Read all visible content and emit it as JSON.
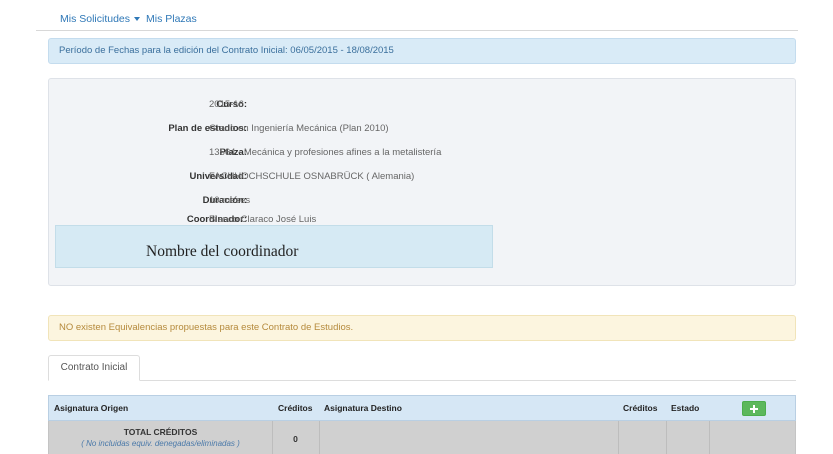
{
  "nav": {
    "solicitudes_label": "Mis Solicitudes",
    "plazas_label": "Mis Plazas"
  },
  "period_alert": "Período de Fechas para la edición del Contrato Inicial: 06/05/2015 - 18/08/2015",
  "info": {
    "rows": [
      {
        "label": "Curso:",
        "value": "2015-16"
      },
      {
        "label": "Plan de estudios:",
        "value": "Grado en Ingeniería Mecánica (Plan 2010)"
      },
      {
        "label": "Plaza:",
        "value": "13564 - Mecánica y profesiones afines a la metalistería"
      },
      {
        "label": "Universidad:",
        "value": "FACHHOCHSCHULE OSNABRÜCK ( Alemania)"
      },
      {
        "label": "Duración:",
        "value": "10 meses"
      },
      {
        "label": "Coordinador:",
        "value": "Blanco Claraco José Luis"
      }
    ]
  },
  "annotation": {
    "text": "Nombre del coordinador"
  },
  "warn_alert": "NO existen Equivalencias propuestas para este Contrato de Estudios.",
  "tabs": [
    {
      "label": "Contrato Inicial",
      "active": true
    }
  ],
  "table": {
    "headers": {
      "asignatura_origen": "Asignatura Origen",
      "creditos_origen": "Créditos",
      "asignatura_destino": "Asignatura Destino",
      "creditos_destino": "Créditos",
      "estado": "Estado"
    },
    "total": {
      "label": "TOTAL CRÉDITOS",
      "sublabel": "( No incluidas equiv. denegadas/eliminadas )",
      "value": "0"
    }
  },
  "colors": {
    "link": "#2f78b7",
    "info_alert_bg": "#d9ebf7",
    "warning_alert_bg": "#fcf5df",
    "success_button": "#5cb85c",
    "table_header_bg": "#d6e7f5"
  }
}
